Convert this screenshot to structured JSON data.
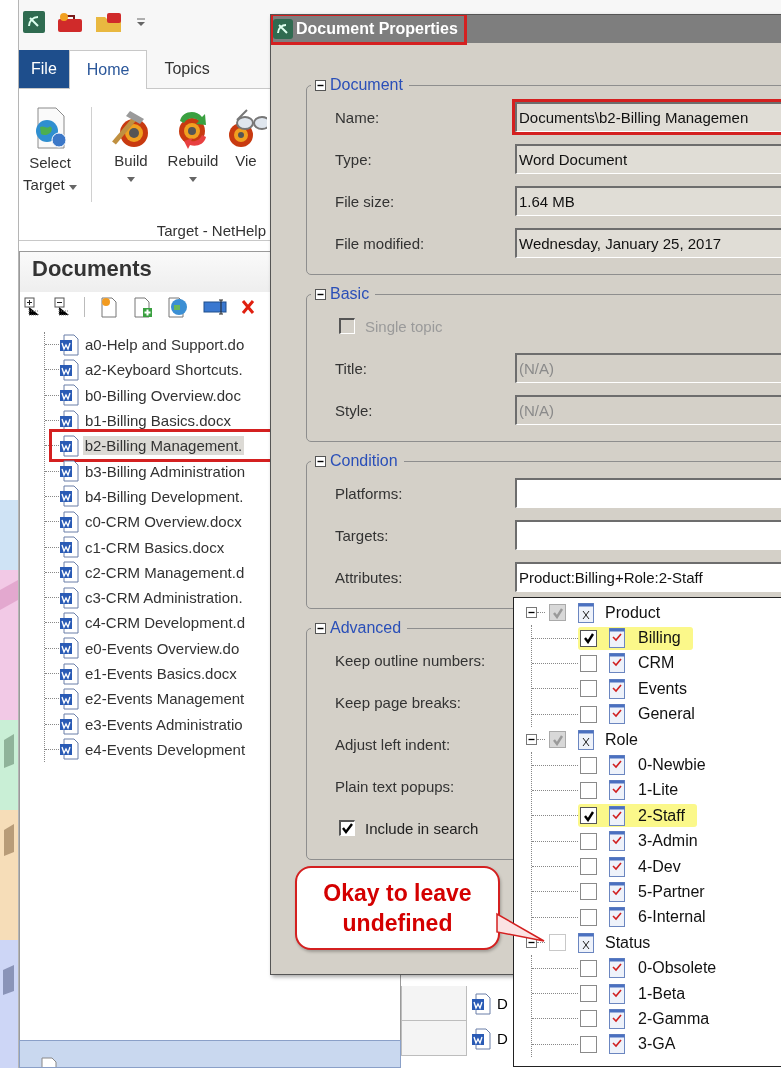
{
  "ribbon": {
    "tabs": [
      {
        "label": "File",
        "kind": "backstage",
        "selected": false
      },
      {
        "label": "Home",
        "kind": "tab",
        "selected": true
      },
      {
        "label": "Topics",
        "kind": "tab",
        "selected": false
      }
    ],
    "buttons": [
      {
        "label": "Select Target",
        "kind": "dropdown"
      },
      {
        "label": "Build",
        "kind": "split"
      },
      {
        "label": "Rebuild",
        "kind": "split"
      },
      {
        "label": "Vie",
        "kind": "plain"
      }
    ],
    "group_label": "Target - NetHelp"
  },
  "documents": {
    "title": "Documents",
    "items": [
      {
        "name": "a0-Help and Support.do",
        "selected": false,
        "annotated": false
      },
      {
        "name": "a2-Keyboard Shortcuts.",
        "selected": false,
        "annotated": false
      },
      {
        "name": "b0-Billing Overview.doc",
        "selected": false,
        "annotated": false
      },
      {
        "name": "b1-Billing Basics.docx",
        "selected": false,
        "annotated": false
      },
      {
        "name": "b2-Billing Management.",
        "selected": true,
        "annotated": true
      },
      {
        "name": "b3-Billing Administration",
        "selected": false,
        "annotated": false
      },
      {
        "name": "b4-Billing Development.",
        "selected": false,
        "annotated": false
      },
      {
        "name": "c0-CRM Overview.docx",
        "selected": false,
        "annotated": false
      },
      {
        "name": "c1-CRM Basics.docx",
        "selected": false,
        "annotated": false
      },
      {
        "name": "c2-CRM Management.d",
        "selected": false,
        "annotated": false
      },
      {
        "name": "c3-CRM Administration.",
        "selected": false,
        "annotated": false
      },
      {
        "name": "c4-CRM Development.d",
        "selected": false,
        "annotated": false
      },
      {
        "name": "e0-Events Overview.do",
        "selected": false,
        "annotated": false
      },
      {
        "name": "e1-Events Basics.docx",
        "selected": false,
        "annotated": false
      },
      {
        "name": "e2-Events Management",
        "selected": false,
        "annotated": false
      },
      {
        "name": "e3-Events Administratio",
        "selected": false,
        "annotated": false
      },
      {
        "name": "e4-Events Development",
        "selected": false,
        "annotated": false
      }
    ]
  },
  "background_pane": {
    "rows": [
      "D",
      "D"
    ]
  },
  "dialog": {
    "title": "Document Properties",
    "title_annotated": true,
    "groups": [
      {
        "title": "Document",
        "expanded": true,
        "fields": [
          {
            "kind": "text",
            "label": "Name:",
            "value": "Documents\\b2-Billing Managemen",
            "readonly": true,
            "disabled": false,
            "annotated": true
          },
          {
            "kind": "text",
            "label": "Type:",
            "value": "Word Document",
            "readonly": true,
            "disabled": false,
            "annotated": false
          },
          {
            "kind": "text",
            "label": "File size:",
            "value": "1.64 MB",
            "readonly": true,
            "disabled": false,
            "annotated": false
          },
          {
            "kind": "text",
            "label": "File modified:",
            "value": "Wednesday, January 25, 2017",
            "readonly": true,
            "disabled": false,
            "annotated": false
          }
        ]
      },
      {
        "title": "Basic",
        "expanded": true,
        "fields": [
          {
            "kind": "checkbox",
            "label": "Single topic",
            "checked": false,
            "disabled": true
          },
          {
            "kind": "text",
            "label": "Title:",
            "value": "(N/A)",
            "readonly": true,
            "disabled": true,
            "annotated": false
          },
          {
            "kind": "text",
            "label": "Style:",
            "value": "(N/A)",
            "readonly": true,
            "disabled": true,
            "annotated": false
          }
        ]
      },
      {
        "title": "Condition",
        "expanded": true,
        "fields": [
          {
            "kind": "text",
            "label": "Platforms:",
            "readonly": false,
            "disabled": false,
            "annotated": false
          },
          {
            "kind": "text",
            "label": "Targets:",
            "readonly": false,
            "disabled": false,
            "annotated": false
          },
          {
            "kind": "text",
            "label": "Attributes:",
            "value": "Product:Billing+Role:2-Staff",
            "readonly": false,
            "disabled": false,
            "annotated": false
          }
        ]
      },
      {
        "title": "Advanced",
        "expanded": true,
        "fields": [
          {
            "kind": "label",
            "label": "Keep outline numbers:",
            "disabled": false
          },
          {
            "kind": "label",
            "label": "Keep page breaks:",
            "disabled": false
          },
          {
            "kind": "label",
            "label": "Adjust left indent:",
            "disabled": false
          },
          {
            "kind": "label",
            "label": "Plain text popups:",
            "disabled": false
          },
          {
            "kind": "checkbox",
            "label": "Include in search",
            "checked": true,
            "disabled": false
          }
        ]
      }
    ]
  },
  "attribute_dropdown": {
    "groups": [
      {
        "name": "Product",
        "expanded": true,
        "partial": true,
        "children": [
          {
            "name": "Billing",
            "checked": true,
            "highlighted": true
          },
          {
            "name": "CRM",
            "checked": false,
            "highlighted": false
          },
          {
            "name": "Events",
            "checked": false,
            "highlighted": false
          },
          {
            "name": "General",
            "checked": false,
            "highlighted": false
          }
        ]
      },
      {
        "name": "Role",
        "expanded": true,
        "partial": true,
        "children": [
          {
            "name": "0-Newbie",
            "checked": false,
            "highlighted": false
          },
          {
            "name": "1-Lite",
            "checked": false,
            "highlighted": false
          },
          {
            "name": "2-Staff",
            "checked": true,
            "highlighted": true
          },
          {
            "name": "3-Admin",
            "checked": false,
            "highlighted": false
          },
          {
            "name": "4-Dev",
            "checked": false,
            "highlighted": false
          },
          {
            "name": "5-Partner",
            "checked": false,
            "highlighted": false
          },
          {
            "name": "6-Internal",
            "checked": false,
            "highlighted": false
          }
        ]
      },
      {
        "name": "Status",
        "expanded": true,
        "partial": false,
        "children": [
          {
            "name": "0-Obsolete",
            "checked": false,
            "highlighted": false
          },
          {
            "name": "1-Beta",
            "checked": false,
            "highlighted": false
          },
          {
            "name": "2-Gamma",
            "checked": false,
            "highlighted": false
          },
          {
            "name": "3-GA",
            "checked": false,
            "highlighted": false
          }
        ]
      }
    ]
  },
  "callout": {
    "text": "Okay to leave undefined"
  }
}
